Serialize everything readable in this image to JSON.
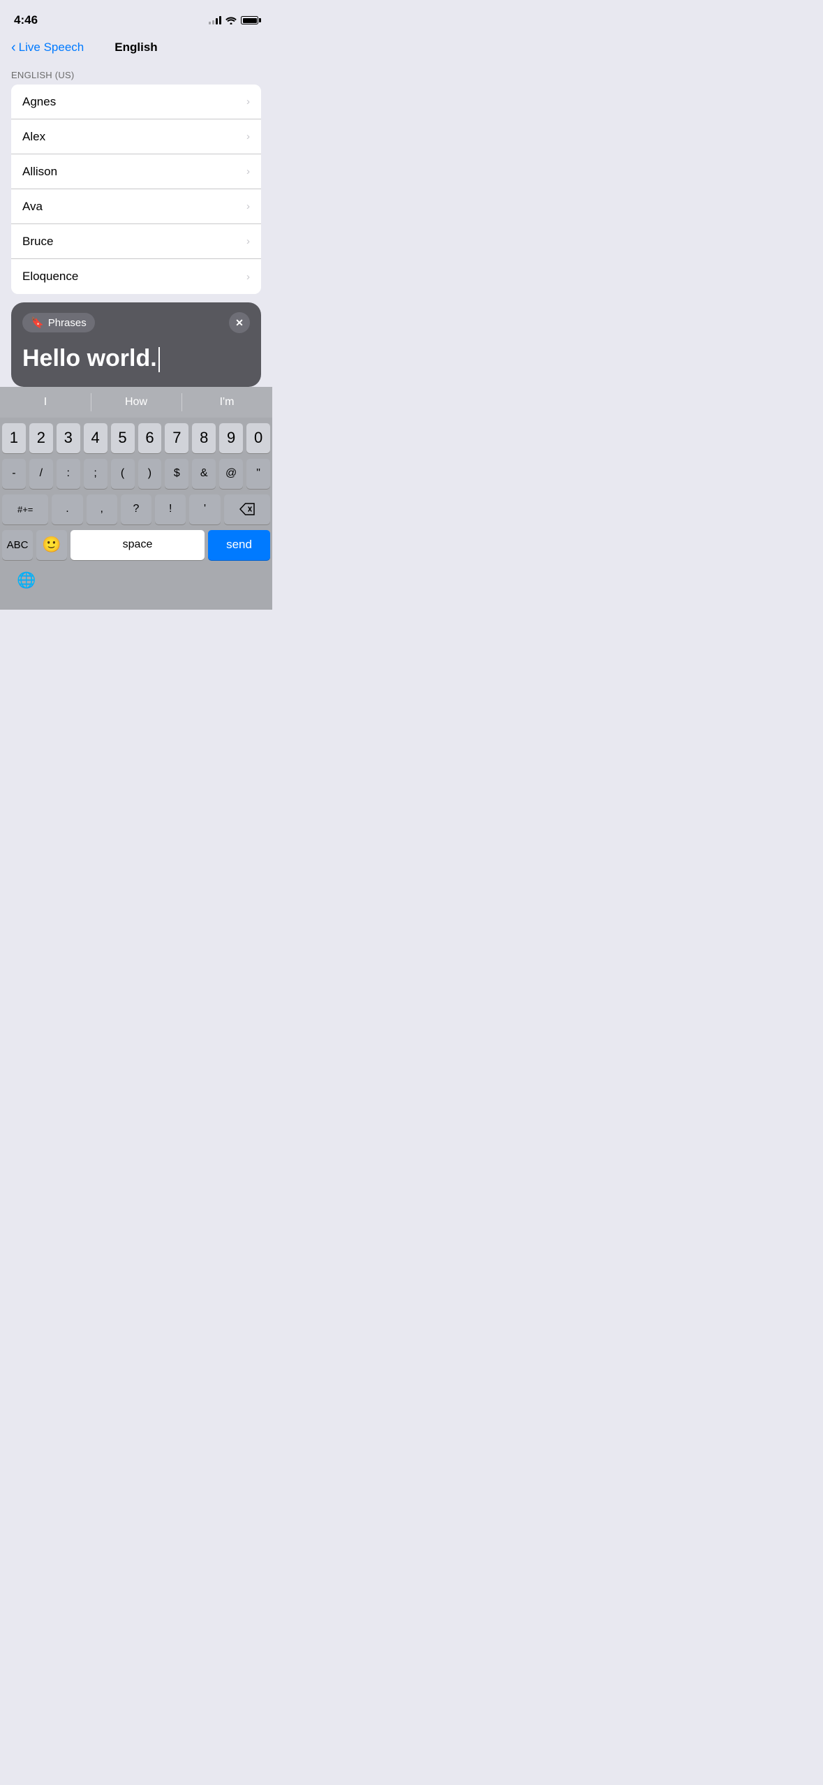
{
  "statusBar": {
    "time": "4:46",
    "batteryFull": true
  },
  "navBar": {
    "backLabel": "Live Speech",
    "title": "English"
  },
  "sectionHeader": "ENGLISH (US)",
  "listItems": [
    {
      "id": "agnes",
      "label": "Agnes"
    },
    {
      "id": "alex",
      "label": "Alex"
    },
    {
      "id": "allison",
      "label": "Allison"
    },
    {
      "id": "ava",
      "label": "Ava"
    },
    {
      "id": "bruce",
      "label": "Bruce"
    },
    {
      "id": "eloquence",
      "label": "Eloquence"
    }
  ],
  "phrasesOverlay": {
    "badgeLabel": "Phrases",
    "text": "Hello world."
  },
  "suggestions": [
    "I",
    "How",
    "I'm"
  ],
  "numberRow": [
    "1",
    "2",
    "3",
    "4",
    "5",
    "6",
    "7",
    "8",
    "9",
    "0"
  ],
  "symbolRow1": [
    "-",
    "/",
    ":",
    ";",
    "(",
    ")",
    "$",
    "&",
    "@",
    "\""
  ],
  "symbolRow2": [
    "#+=",
    ".",
    ",",
    "?",
    "!",
    "'"
  ],
  "bottomRow": {
    "abc": "ABC",
    "space": "space",
    "send": "send"
  },
  "icons": {
    "bookmark": "🔖",
    "globe": "🌐",
    "emoji": "😀"
  }
}
